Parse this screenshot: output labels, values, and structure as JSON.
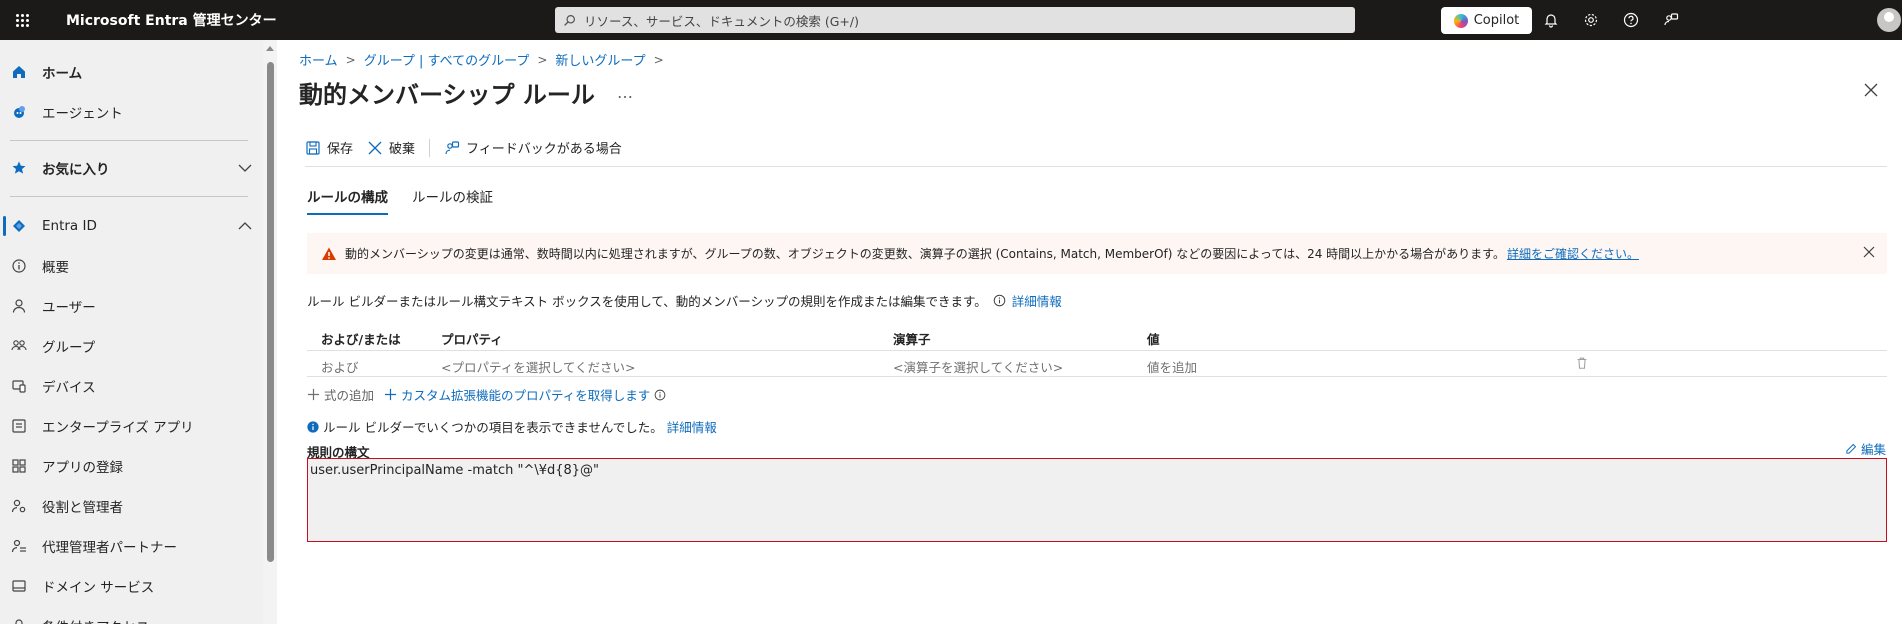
{
  "topbar": {
    "brand": "Microsoft Entra 管理センター",
    "search_placeholder": "リソース、サービス、ドキュメントの検索 (G+/)",
    "copilot_label": "Copilot"
  },
  "sidebar": {
    "items": [
      {
        "label": "ホーム",
        "icon": "home-icon"
      },
      {
        "label": "エージェント",
        "icon": "agent-icon"
      },
      {
        "label": "お気に入り",
        "icon": "star-icon"
      },
      {
        "label": "Entra ID",
        "icon": "entra-id-icon"
      },
      {
        "label": "概要",
        "icon": "info-circle-icon"
      },
      {
        "label": "ユーザー",
        "icon": "user-icon"
      },
      {
        "label": "グループ",
        "icon": "group-icon"
      },
      {
        "label": "デバイス",
        "icon": "device-icon"
      },
      {
        "label": "エンタープライズ アプリ",
        "icon": "enterprise-apps-icon"
      },
      {
        "label": "アプリの登録",
        "icon": "app-registrations-icon"
      },
      {
        "label": "役割と管理者",
        "icon": "roles-icon"
      },
      {
        "label": "代理管理者パートナー",
        "icon": "partner-icon"
      },
      {
        "label": "ドメイン サービス",
        "icon": "domain-services-icon"
      },
      {
        "label": "条件付きアクセス",
        "icon": "conditional-access-icon"
      }
    ]
  },
  "breadcrumb": [
    "ホーム",
    "グループ | すべてのグループ",
    "新しいグループ"
  ],
  "page": {
    "title": "動的メンバーシップ ルール",
    "more": "…"
  },
  "commands": {
    "save": "保存",
    "discard": "破棄",
    "feedback": "フィードバックがある場合"
  },
  "tabs": [
    "ルールの構成",
    "ルールの検証"
  ],
  "warning": {
    "text": "動的メンバーシップの変更は通常、数時間以内に処理されますが、グループの数、オブジェクトの変更数、演算子の選択 (Contains, Match, MemberOf) などの要因によっては、24 時間以上かかる場合があります。",
    "link": "詳細をご確認ください。"
  },
  "description": {
    "text": "ルール ビルダーまたはルール構文テキスト ボックスを使用して、動的メンバーシップの規則を作成または編集できます。",
    "link": "詳細情報"
  },
  "table": {
    "headers": [
      "および/または",
      "プロパティ",
      "演算子",
      "値"
    ],
    "rows": [
      [
        "および",
        "<プロパティを選択してください>",
        "<演算子を選択してください>",
        "値を追加"
      ]
    ]
  },
  "actions": {
    "add_expression": "式の追加",
    "custom_extension": "カスタム拡張機能のプロパティを取得します"
  },
  "info_message": {
    "text": "ルール ビルダーでいくつかの項目を表示できませんでした。",
    "link": "詳細情報"
  },
  "syntax": {
    "label": "規則の構文",
    "edit": "編集",
    "value": "user.userPrincipalName -match \"^\\¥d{8}@\""
  },
  "colors": {
    "accent": "#0f6cbd",
    "topbar": "#1b1a19",
    "warning_icon": "#da3b01",
    "error_border": "#c50f1f"
  }
}
